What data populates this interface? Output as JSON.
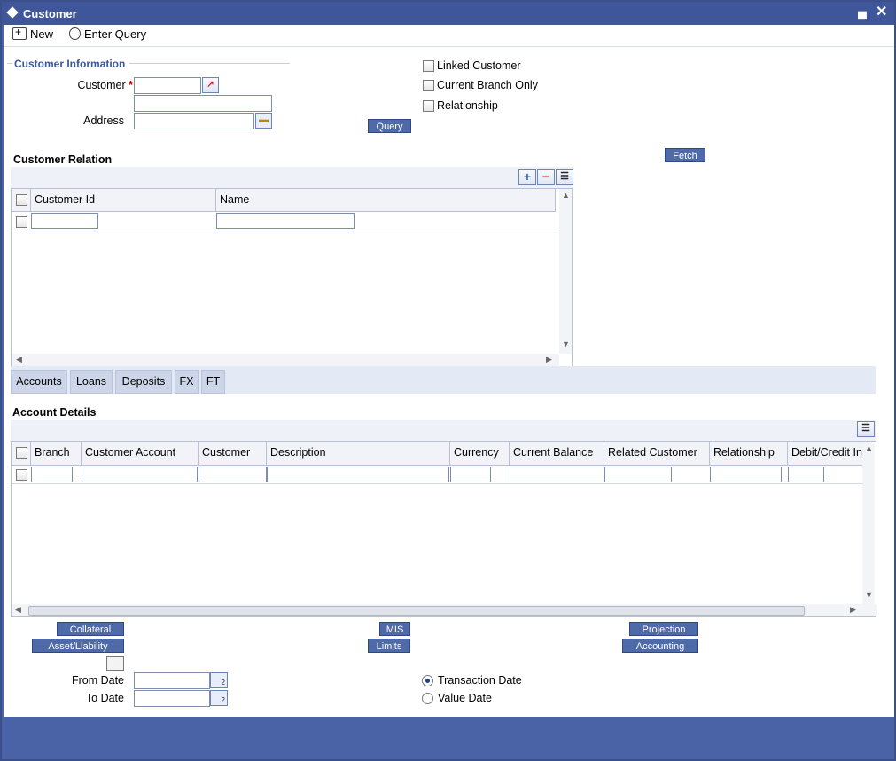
{
  "window": {
    "title": "Customer"
  },
  "toolbar": {
    "new_label": "New",
    "enter_query_label": "Enter Query"
  },
  "customer_info": {
    "section_title": "Customer Information",
    "customer_label": "Customer",
    "required_mark": "*",
    "address_label": "Address",
    "query_button": "Query",
    "checkboxes": [
      "Linked Customer",
      "Current Branch Only",
      "Relationship"
    ]
  },
  "fetch_button": "Fetch",
  "customer_relation": {
    "title": "Customer Relation",
    "columns": [
      "Customer Id",
      "Name"
    ]
  },
  "tabs": [
    "Accounts",
    "Loans",
    "Deposits",
    "FX",
    "FT"
  ],
  "account_details": {
    "title": "Account Details",
    "columns": [
      "Branch",
      "Customer Account",
      "Customer",
      "Description",
      "Currency",
      "Current Balance",
      "Related Customer",
      "Relationship",
      "Debit/Credit In"
    ]
  },
  "buttons": {
    "collateral": "Collateral",
    "asset_liability": "Asset/Liability",
    "mis": "MIS",
    "limits": "Limits",
    "projection": "Projection",
    "accounting": "Accounting"
  },
  "dates": {
    "from_label": "From Date",
    "to_label": "To Date",
    "transaction_date": "Transaction Date",
    "value_date": "Value Date",
    "selected": "Transaction Date"
  }
}
